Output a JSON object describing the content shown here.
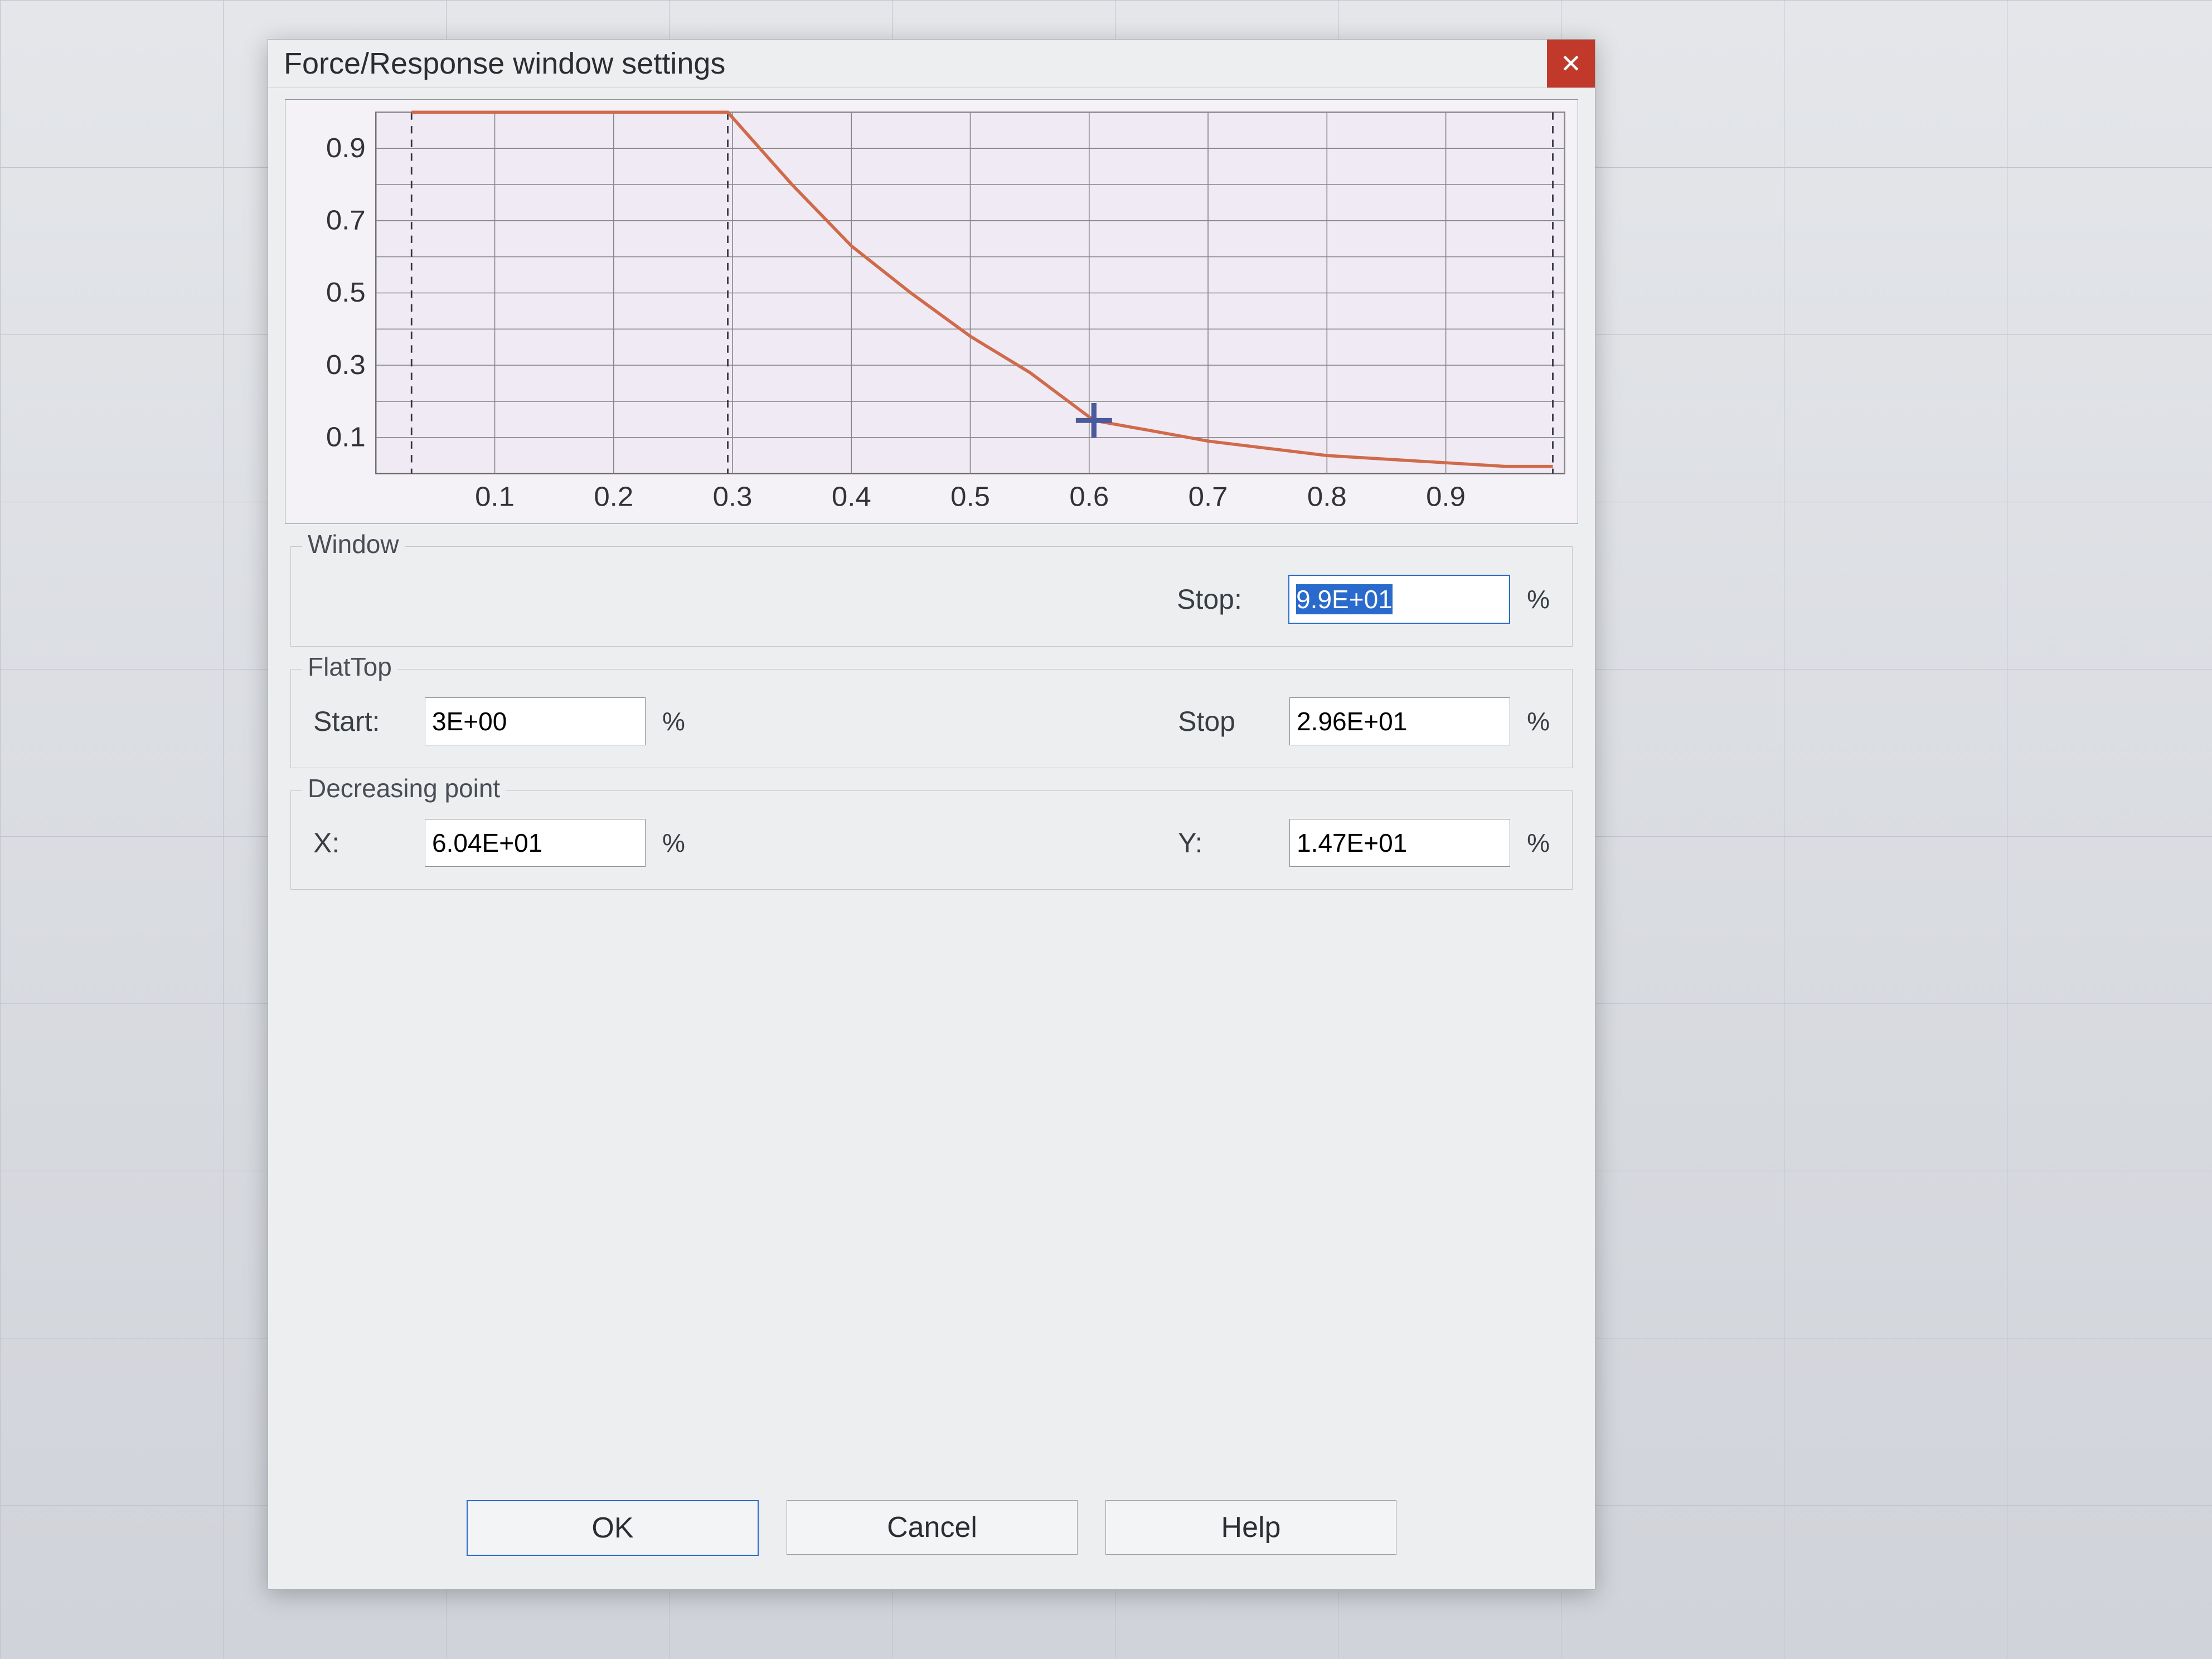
{
  "dialog": {
    "title": "Force/Response window settings",
    "close_glyph": "✕"
  },
  "groups": {
    "window": {
      "legend": "Window",
      "stop_label": "Stop:",
      "stop_value": "9.9E+01",
      "stop_unit": "%"
    },
    "flattop": {
      "legend": "FlatTop",
      "start_label": "Start:",
      "start_value": "3E+00",
      "start_unit": "%",
      "stop_label": "Stop",
      "stop_value": "2.96E+01",
      "stop_unit": "%"
    },
    "decreasing": {
      "legend": "Decreasing point",
      "x_label": "X:",
      "x_value": "6.04E+01",
      "x_unit": "%",
      "y_label": "Y:",
      "y_value": "1.47E+01",
      "y_unit": "%"
    }
  },
  "buttons": {
    "ok": "OK",
    "cancel": "Cancel",
    "help": "Help"
  },
  "chart_data": {
    "type": "line",
    "title": "",
    "xlabel": "",
    "ylabel": "",
    "xlim": [
      0,
      1
    ],
    "ylim": [
      0,
      1
    ],
    "x_ticks": [
      0.1,
      0.2,
      0.3,
      0.4,
      0.5,
      0.6,
      0.7,
      0.8,
      0.9
    ],
    "y_ticks": [
      0.1,
      0.3,
      0.5,
      0.7,
      0.9
    ],
    "vertical_guides_dashed": [
      0.03,
      0.296,
      0.99
    ],
    "cross_marker": {
      "x": 0.604,
      "y": 0.147
    },
    "series": [
      {
        "name": "window-curve",
        "color": "#d06a4a",
        "x": [
          0.03,
          0.05,
          0.1,
          0.15,
          0.2,
          0.25,
          0.296,
          0.35,
          0.4,
          0.45,
          0.5,
          0.55,
          0.604,
          0.65,
          0.7,
          0.75,
          0.8,
          0.85,
          0.9,
          0.95,
          0.99
        ],
        "y": [
          1.0,
          1.0,
          1.0,
          1.0,
          1.0,
          1.0,
          1.0,
          0.8,
          0.63,
          0.5,
          0.38,
          0.28,
          0.147,
          0.12,
          0.09,
          0.07,
          0.05,
          0.04,
          0.03,
          0.02,
          0.02
        ]
      }
    ]
  }
}
